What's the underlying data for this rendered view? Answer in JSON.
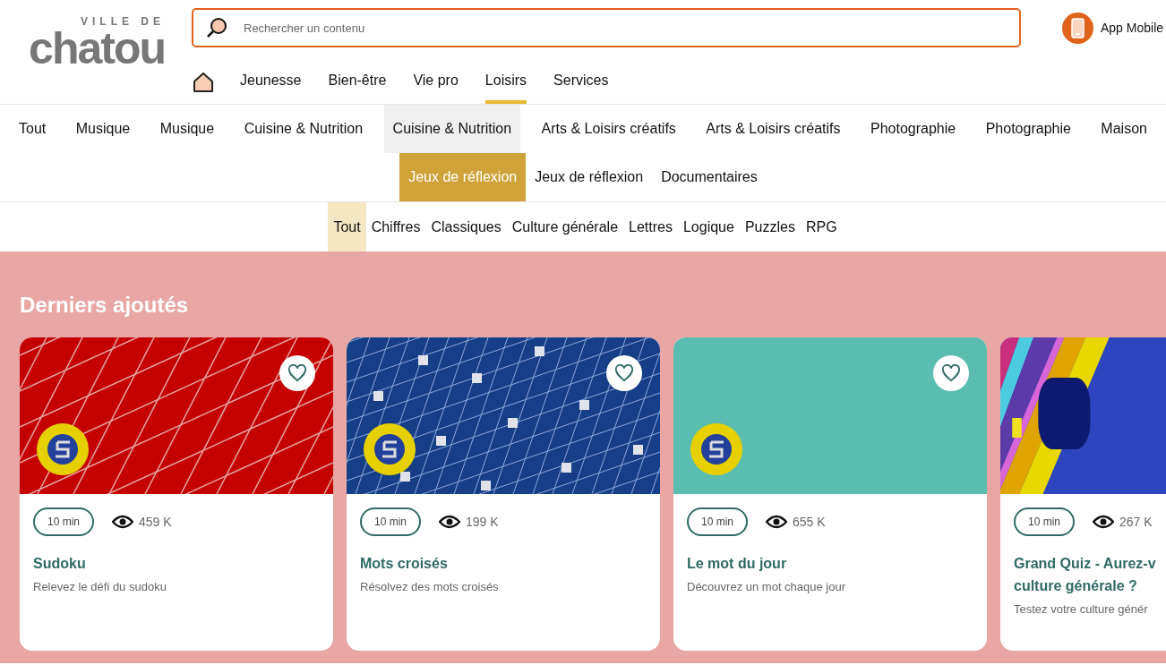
{
  "logo": {
    "tagline": "VILLE DE",
    "name": "chatou"
  },
  "search": {
    "placeholder": "Rechercher un contenu"
  },
  "app_link": {
    "label": "App Mobile"
  },
  "main_nav": [
    {
      "label": "Jeunesse",
      "selected": false
    },
    {
      "label": "Bien-être",
      "selected": false
    },
    {
      "label": "Vie pro",
      "selected": false
    },
    {
      "label": "Loisirs",
      "selected": true
    },
    {
      "label": "Services",
      "selected": false
    }
  ],
  "categories": [
    [
      {
        "label": "Tout",
        "selected": false,
        "hovered": false
      },
      {
        "label": "Musique",
        "selected": false,
        "hovered": false
      },
      {
        "label": "Musique",
        "selected": false,
        "hovered": false
      },
      {
        "label": "Cuisine & Nutrition",
        "selected": false,
        "hovered": false
      },
      {
        "label": "Cuisine & Nutrition",
        "selected": false,
        "hovered": true
      },
      {
        "label": "Arts & Loisirs créatifs",
        "selected": false,
        "hovered": false
      },
      {
        "label": "Arts & Loisirs créatifs",
        "selected": false,
        "hovered": false
      },
      {
        "label": "Photographie",
        "selected": false,
        "hovered": false
      },
      {
        "label": "Photographie",
        "selected": false,
        "hovered": false
      },
      {
        "label": "Maison",
        "selected": false,
        "hovered": false
      }
    ],
    [
      {
        "label": "Jeux de réflexion",
        "selected": true,
        "hovered": false
      },
      {
        "label": "Jeux de réflexion",
        "selected": false,
        "hovered": false
      },
      {
        "label": "Documentaires",
        "selected": false,
        "hovered": false
      }
    ]
  ],
  "subcategories": [
    {
      "label": "Tout",
      "selected": true
    },
    {
      "label": "Chiffres",
      "selected": false
    },
    {
      "label": "Classiques",
      "selected": false
    },
    {
      "label": "Culture générale",
      "selected": false
    },
    {
      "label": "Lettres",
      "selected": false
    },
    {
      "label": "Logique",
      "selected": false
    },
    {
      "label": "Puzzles",
      "selected": false
    },
    {
      "label": "RPG",
      "selected": false
    }
  ],
  "section": {
    "title": "Derniers ajoutés",
    "cards": [
      {
        "kind": "sudoku",
        "badge": true,
        "favorite": false,
        "duration": "10 min",
        "views": "459 K",
        "title": "Sudoku",
        "description": "Relevez le défi du sudoku"
      },
      {
        "kind": "crossword",
        "badge": true,
        "favorite": false,
        "duration": "10 min",
        "views": "199 K",
        "title": "Mots croisés",
        "description": "Résolvez des mots croisés"
      },
      {
        "kind": "chalkboard",
        "badge": true,
        "favorite": false,
        "duration": "10 min",
        "views": "655 K",
        "title": "Le mot du jour",
        "description": "Découvrez un mot chaque jour"
      },
      {
        "kind": "quiz",
        "badge": false,
        "duration": "10 min",
        "views": "267 K",
        "title": "Grand Quiz - Aurez-v",
        "title_line2": "culture générale ?",
        "description": "Testez votre culture génér"
      }
    ]
  }
}
